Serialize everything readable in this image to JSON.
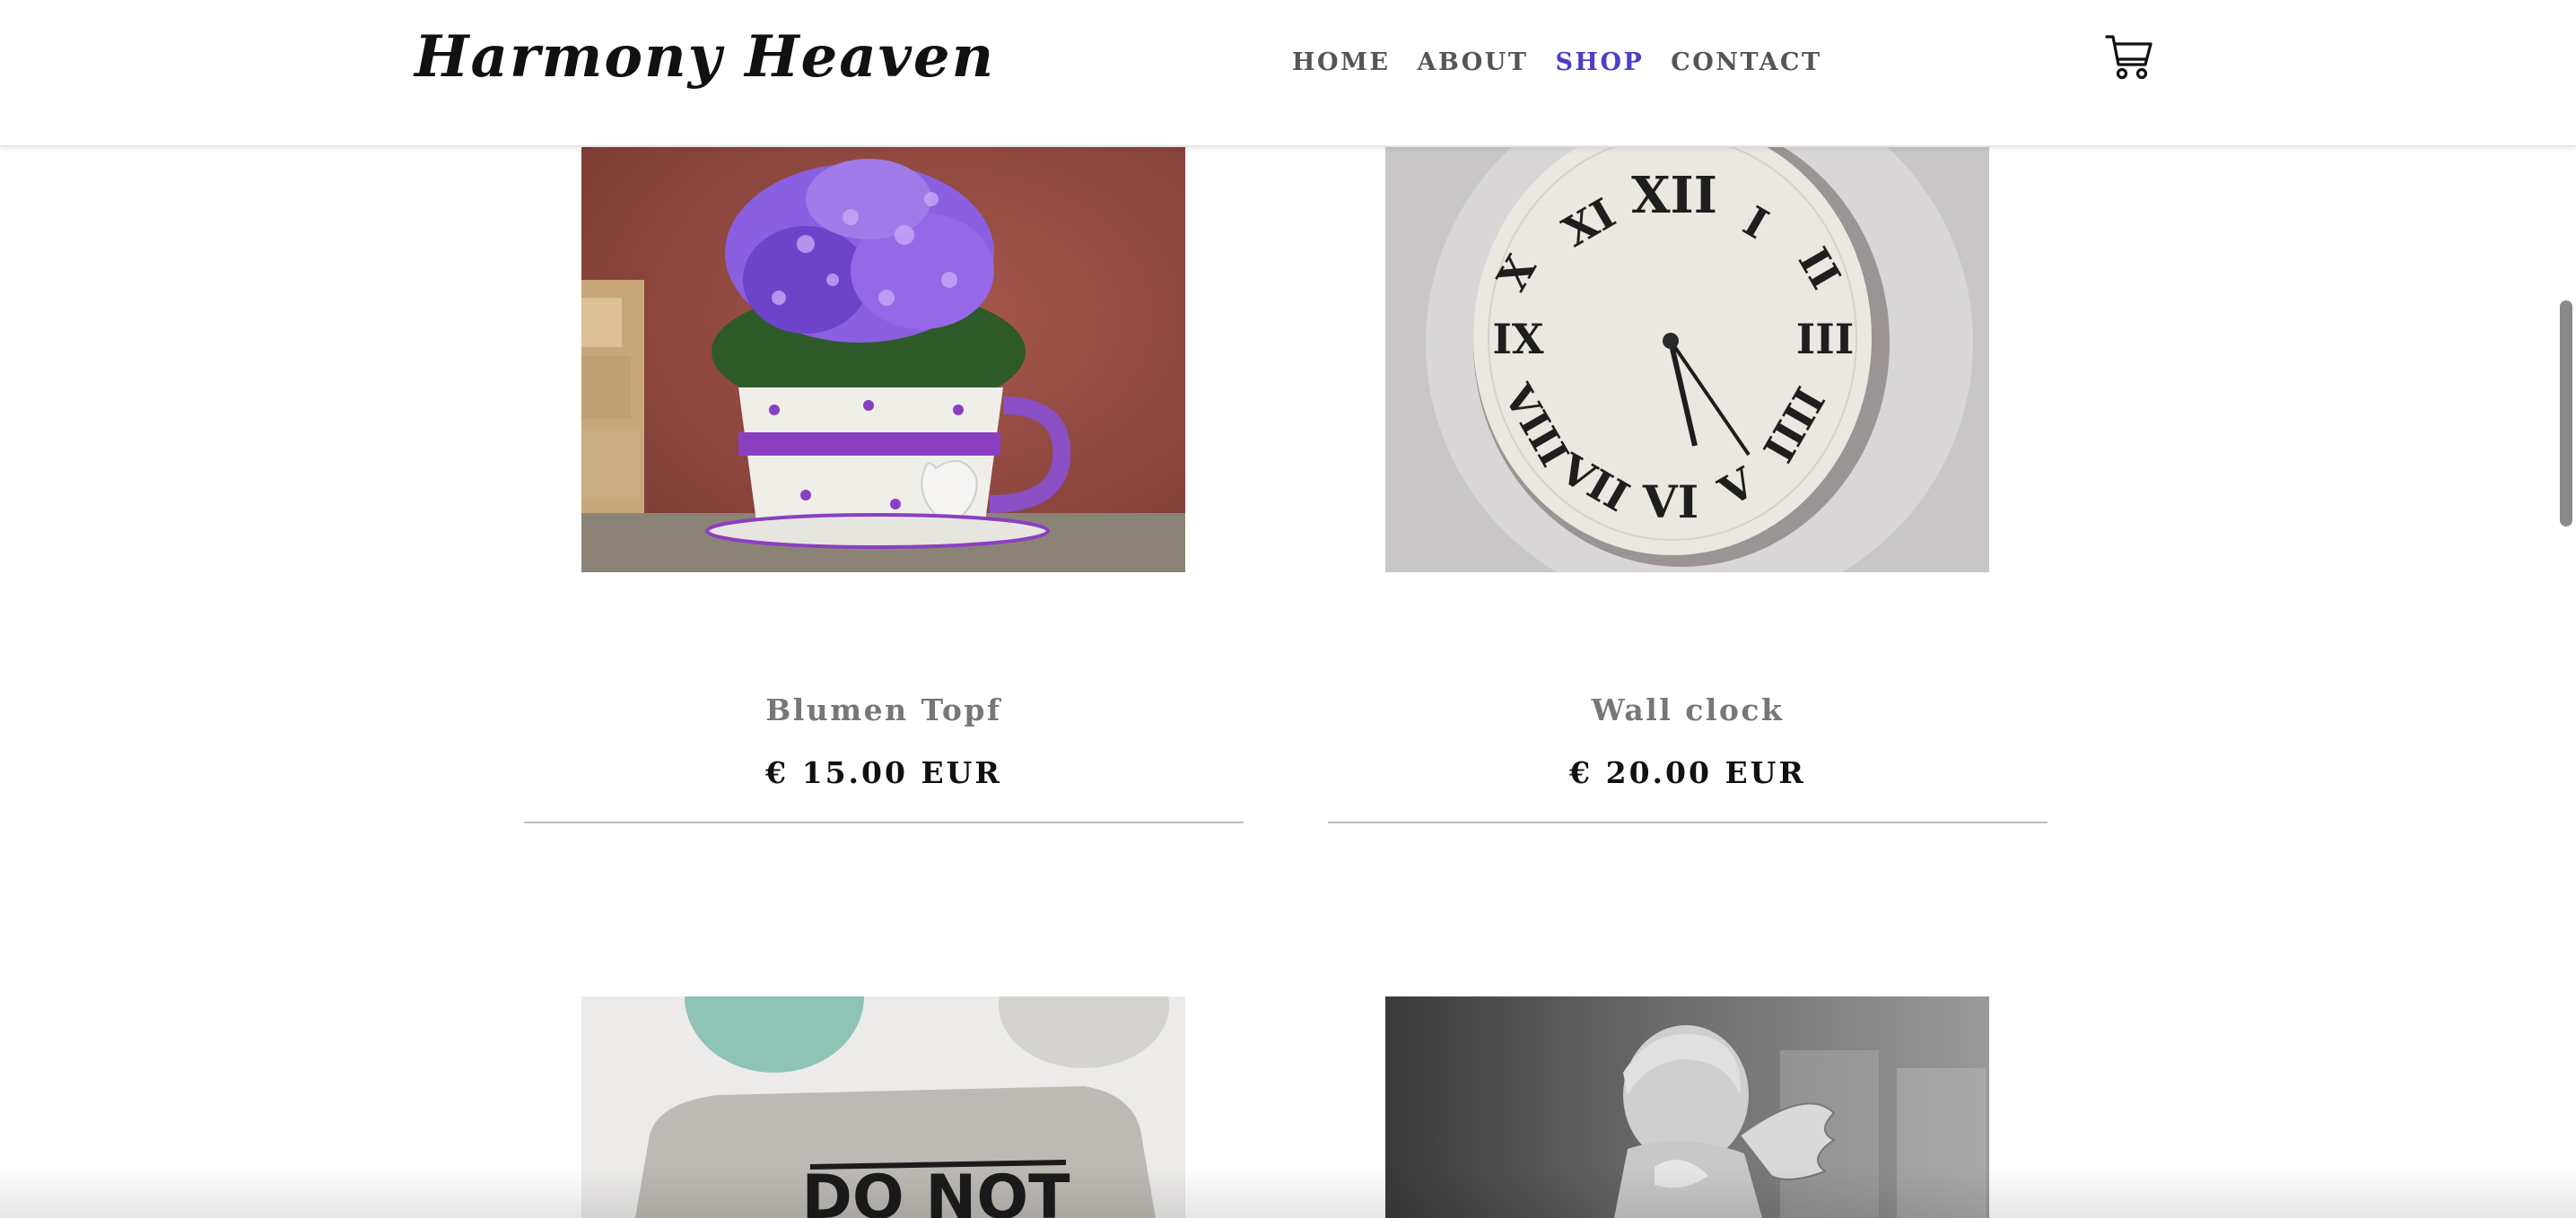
{
  "header": {
    "logo": "Harmony Heaven",
    "nav": [
      {
        "label": "HOME",
        "active": false
      },
      {
        "label": "ABOUT",
        "active": false
      },
      {
        "label": "SHOP",
        "active": true
      },
      {
        "label": "CONTACT",
        "active": false
      }
    ],
    "cart_icon": "shopping-cart-icon"
  },
  "colors": {
    "accent": "#4a3fc7",
    "nav_text": "#555555",
    "product_name": "#777777",
    "price": "#111111"
  },
  "products": [
    {
      "name": "Blumen Topf",
      "price": "€ 15.00 EUR",
      "image": "purple-flowers-teacup-pot"
    },
    {
      "name": "Wall clock",
      "price": "€ 20.00 EUR",
      "image": "roman-numeral-wall-clock"
    },
    {
      "name": "",
      "price": "",
      "image": "do-not-disturb-pillow",
      "image_text": "DO NOT"
    },
    {
      "name": "",
      "price": "",
      "image": "cherub-angel-statue"
    }
  ]
}
